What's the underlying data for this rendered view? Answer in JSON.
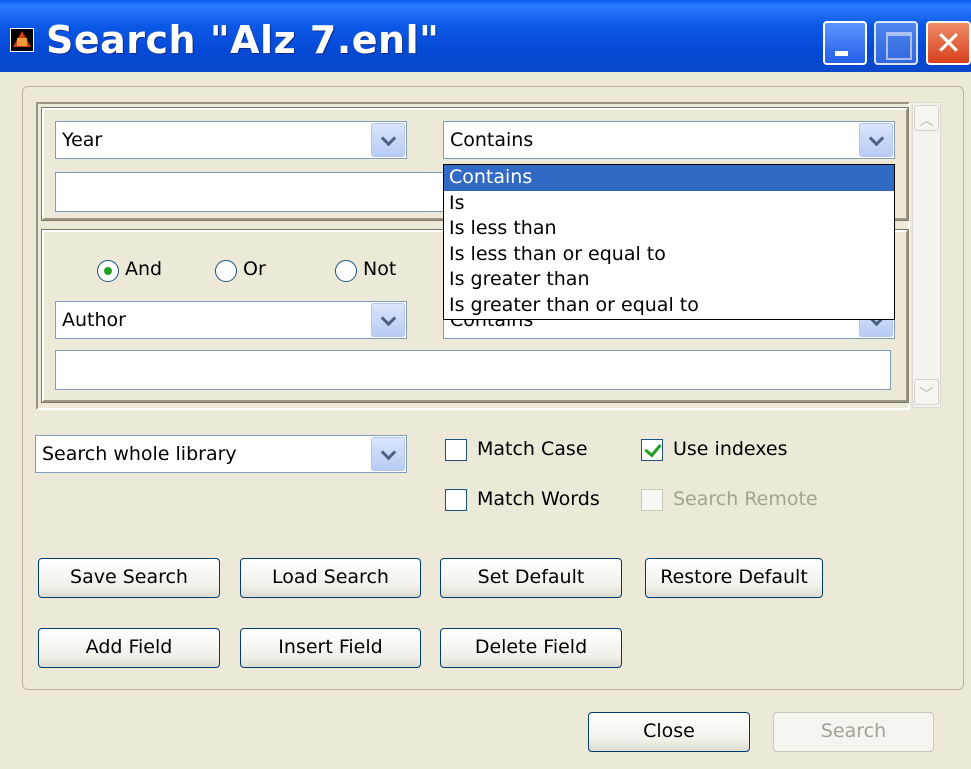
{
  "window": {
    "title": "Search \"Alz 7.enl\"",
    "icon": "endnote-app-icon",
    "controls": {
      "close_glyph": "✕"
    }
  },
  "criteria": [
    {
      "field": "Year",
      "operator": "Contains",
      "value": ""
    },
    {
      "connector_options": [
        "And",
        "Or",
        "Not"
      ],
      "connector_selected": "And",
      "field": "Author",
      "operator": "Contains",
      "value": ""
    }
  ],
  "operator_dropdown": {
    "open": true,
    "items": [
      "Contains",
      "Is",
      "Is less than",
      "Is less than or equal to",
      "Is greater than",
      "Is greater than or equal to"
    ],
    "selected_index": 0
  },
  "scope": {
    "value": "Search whole library"
  },
  "options": {
    "match_case": {
      "label": "Match Case",
      "checked": false
    },
    "use_indexes": {
      "label": "Use indexes",
      "checked": true
    },
    "match_words": {
      "label": "Match Words",
      "checked": false
    },
    "search_remote": {
      "label": "Search Remote",
      "checked": false,
      "enabled": false
    }
  },
  "buttons": {
    "save_search": "Save Search",
    "load_search": "Load Search",
    "set_default": "Set Default",
    "restore_default": "Restore Default",
    "add_field": "Add Field",
    "insert_field": "Insert Field",
    "delete_field": "Delete Field",
    "close": "Close",
    "search": "Search"
  },
  "colors": {
    "titlebar": "#0549d6",
    "dialog_bg": "#ece9d8",
    "selection": "#316ac5",
    "check_green": "#21a121"
  }
}
